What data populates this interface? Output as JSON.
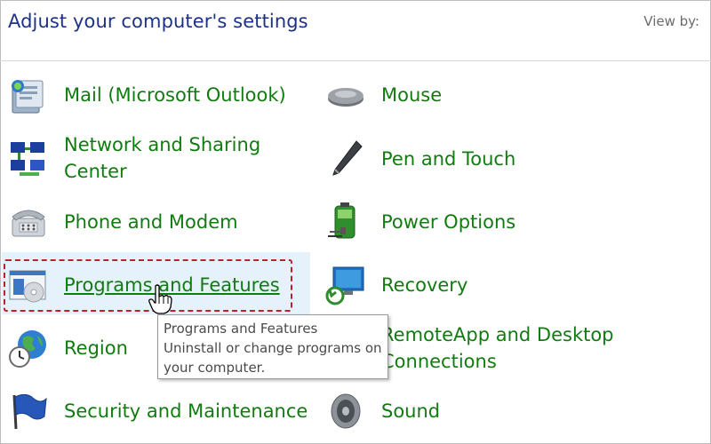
{
  "header": {
    "title": "Adjust your computer's settings",
    "view_by_label": "View by:"
  },
  "items": [
    {
      "label": "Mail (Microsoft Outlook)",
      "icon": "mail-icon"
    },
    {
      "label_line1": "Network and Sharing",
      "label_line2": "Center",
      "icon": "network-icon"
    },
    {
      "label": "Phone and Modem",
      "icon": "phone-icon"
    },
    {
      "label": "Programs and Features",
      "icon": "programs-icon",
      "state": "hovered"
    },
    {
      "label": "Region",
      "icon": "globe-clock-icon"
    },
    {
      "label": "Security and Maintenance",
      "icon": "flag-icon"
    },
    {
      "label": "Mouse",
      "icon": "mouse-icon"
    },
    {
      "label": "Pen and Touch",
      "icon": "pen-icon"
    },
    {
      "label": "Power Options",
      "icon": "battery-icon"
    },
    {
      "label": "Recovery",
      "icon": "monitor-restore-icon"
    },
    {
      "label_line1": "RemoteApp and Desktop",
      "label_line2": "Connections",
      "icon": "remote-desktop-icon"
    },
    {
      "label": "Sound",
      "icon": "speaker-icon"
    }
  ],
  "tooltip": {
    "title": "Programs and Features",
    "line1": "Uninstall or change programs on",
    "line2": "your computer."
  },
  "colors": {
    "title": "#1e3287",
    "link": "#107c10",
    "hover_bg": "#e5f1fb",
    "annotation": "#c0202c"
  }
}
